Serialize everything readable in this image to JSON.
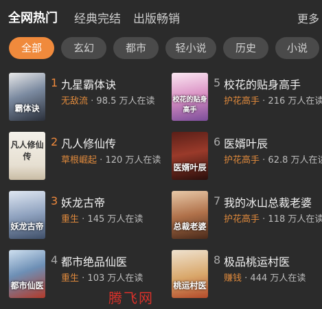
{
  "header": {
    "tabs": [
      {
        "label": "全网热门",
        "active": true
      },
      {
        "label": "经典完结",
        "active": false
      },
      {
        "label": "出版畅销",
        "active": false
      }
    ],
    "more_label": "更多"
  },
  "filters": [
    {
      "label": "全部",
      "active": true
    },
    {
      "label": "玄幻",
      "active": false
    },
    {
      "label": "都市",
      "active": false
    },
    {
      "label": "轻小说",
      "active": false
    },
    {
      "label": "历史",
      "active": false
    },
    {
      "label": "小说",
      "active": false
    }
  ],
  "books": [
    {
      "rank": "1",
      "title": "九星霸体诀",
      "tag": "无敌流",
      "readers": "98.5 万人在读",
      "cover_text": "霸体诀"
    },
    {
      "rank": "2",
      "title": "凡人修仙传",
      "tag": "草根崛起",
      "readers": "120 万人在读",
      "cover_text": "凡人修仙传"
    },
    {
      "rank": "3",
      "title": "妖龙古帝",
      "tag": "重生",
      "readers": "145 万人在读",
      "cover_text": "妖龙古帝"
    },
    {
      "rank": "4",
      "title": "都市绝品仙医",
      "tag": "重生",
      "readers": "103 万人在读",
      "cover_text": "都市仙医"
    },
    {
      "rank": "5",
      "title": "校花的贴身高手",
      "tag": "护花高手",
      "readers": "216 万人在读",
      "cover_text": "校花的贴身高手"
    },
    {
      "rank": "6",
      "title": "医婿叶辰",
      "tag": "护花高手",
      "readers": "62.8 万人在读",
      "cover_text": "医婿叶辰"
    },
    {
      "rank": "7",
      "title": "我的冰山总裁老婆",
      "tag": "护花高手",
      "readers": "118 万人在读",
      "cover_text": "总裁老婆"
    },
    {
      "rank": "8",
      "title": "极品桃运村医",
      "tag": "赚钱",
      "readers": "444 万人在读",
      "cover_text": "桃运村医"
    }
  ],
  "meta_separator": " · ",
  "watermark": "腾飞网",
  "colors": {
    "accent": "#f08a3c",
    "background": "#2b2b2b",
    "chip": "#4a4a4a",
    "watermark": "#d8312a"
  }
}
